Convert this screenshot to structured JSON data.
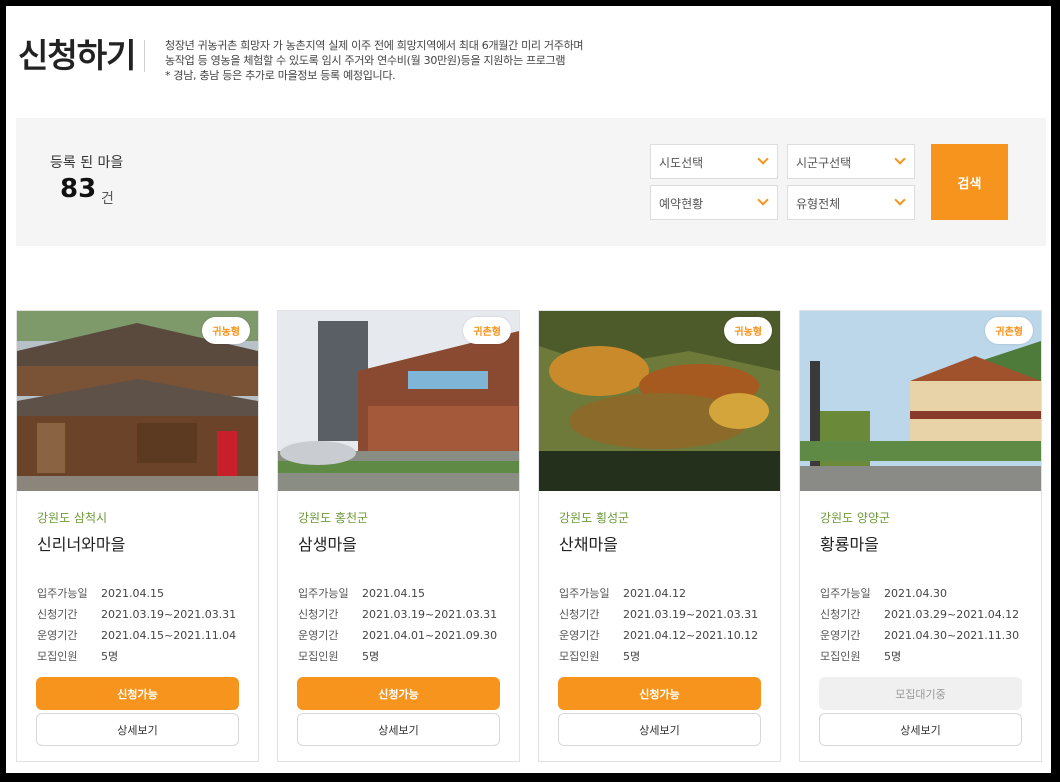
{
  "header": {
    "title": "신청하기",
    "desc_line1": "청장년 귀농귀촌 희망자 가 농촌지역 실제 이주 전에 희망지역에서 최대 6개월간 미리 거주하며",
    "desc_line2": "농작업 등 영농을 체험할 수 있도록 임시 주거와 연수비(월 30만원)등을 지원하는 프로그램",
    "desc_line3": "* 경남, 충남 등은 추가로 마을정보 등록 예정입니다."
  },
  "search": {
    "count_label": "등록 된 마을",
    "count_value": "83",
    "count_unit": "건",
    "sido_select": "시도선택",
    "sigungu_select": "시군구선택",
    "reservation_select": "예약현황",
    "type_select": "유형전체",
    "search_button": "검색"
  },
  "labels": {
    "move_in": "입주가능일",
    "apply_period": "신청기간",
    "operation_period": "운영기간",
    "recruits": "모집인원",
    "detail": "상세보기"
  },
  "cards": [
    {
      "type": "귀농형",
      "region": "강원도 삼척시",
      "name": "신리너와마을",
      "move_in": "2021.04.15",
      "apply_period": "2021.03.19~2021.03.31",
      "operation_period": "2021.04.15~2021.11.04",
      "recruits": "5명",
      "status": "신청가능"
    },
    {
      "type": "귀촌형",
      "region": "강원도 홍천군",
      "name": "삼생마을",
      "move_in": "2021.04.15",
      "apply_period": "2021.03.19~2021.03.31",
      "operation_period": "2021.04.01~2021.09.30",
      "recruits": "5명",
      "status": "신청가능"
    },
    {
      "type": "귀농형",
      "region": "강원도 횡성군",
      "name": "산채마을",
      "move_in": "2021.04.12",
      "apply_period": "2021.03.19~2021.03.31",
      "operation_period": "2021.04.12~2021.10.12",
      "recruits": "5명",
      "status": "신청가능"
    },
    {
      "type": "귀촌형",
      "region": "강원도 양양군",
      "name": "황룡마을",
      "move_in": "2021.04.30",
      "apply_period": "2021.03.29~2021.04.12",
      "operation_period": "2021.04.30~2021.11.30",
      "recruits": "5명",
      "status": "모집대기중"
    }
  ],
  "colors": {
    "accent": "#f7941d",
    "region_text": "#6e9a3a",
    "panel_bg": "#f5f5f5"
  }
}
